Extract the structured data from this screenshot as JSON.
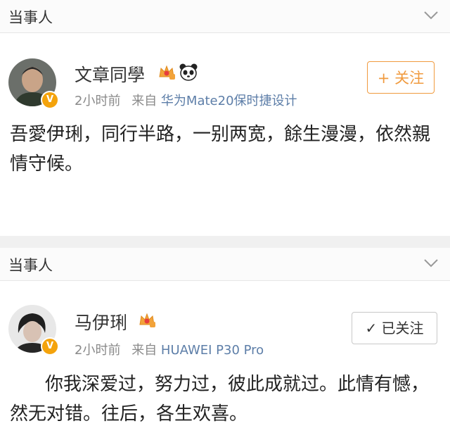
{
  "header1": {
    "title": "当事人"
  },
  "post1": {
    "username": "文章同學",
    "badges": [
      "crown-icon",
      "panda-icon"
    ],
    "time": "2小时前",
    "source_prefix": "来自",
    "source_device": "华为Mate20保时捷设计",
    "follow_label": "+ 关注",
    "text": "吾愛伊琍，同行半路，一别两宽，餘生漫漫，依然親情守候。"
  },
  "header2": {
    "title": "当事人"
  },
  "post2": {
    "username": "马伊琍",
    "badges": [
      "crown-icon"
    ],
    "time": "2小时前",
    "source_prefix": "来自",
    "source_device": "HUAWEI P30 Pro",
    "follow_label": "✓ 已关注",
    "text": "你我深爱过，努力过，彼此成就过。此情有憾，然无对错。往后，各生欢喜。"
  },
  "colors": {
    "accent_orange": "#f09a3e",
    "verified_badge": "#f4a30c",
    "device_link": "#5d7ea8"
  }
}
